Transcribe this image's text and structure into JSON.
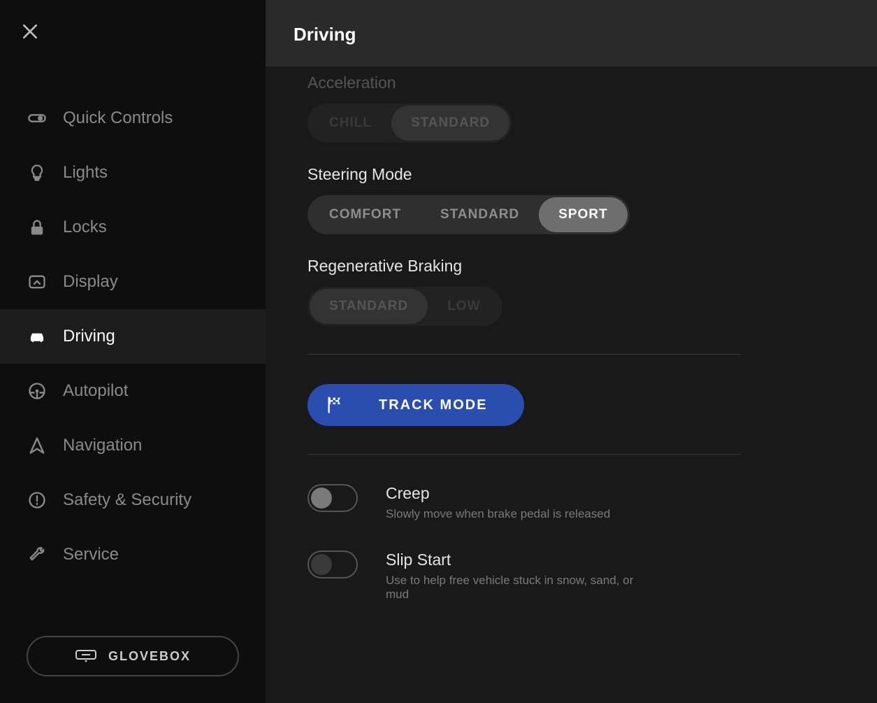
{
  "header": {
    "title": "Driving"
  },
  "sidebar": {
    "items": [
      {
        "label": "Quick Controls"
      },
      {
        "label": "Lights"
      },
      {
        "label": "Locks"
      },
      {
        "label": "Display"
      },
      {
        "label": "Driving"
      },
      {
        "label": "Autopilot"
      },
      {
        "label": "Navigation"
      },
      {
        "label": "Safety & Security"
      },
      {
        "label": "Service"
      }
    ],
    "glovebox_label": "GLOVEBOX"
  },
  "acceleration": {
    "label": "Acceleration",
    "options": [
      "CHILL",
      "STANDARD"
    ],
    "selected": "STANDARD"
  },
  "steering": {
    "label": "Steering Mode",
    "options": [
      "COMFORT",
      "STANDARD",
      "SPORT"
    ],
    "selected": "SPORT"
  },
  "regen": {
    "label": "Regenerative Braking",
    "options": [
      "STANDARD",
      "LOW"
    ],
    "selected": "STANDARD"
  },
  "track_mode": {
    "label": "TRACK MODE"
  },
  "creep": {
    "title": "Creep",
    "description": "Slowly move when brake pedal is released",
    "value": false
  },
  "slip_start": {
    "title": "Slip Start",
    "description": "Use to help free vehicle stuck in snow, sand, or mud",
    "value": false
  }
}
